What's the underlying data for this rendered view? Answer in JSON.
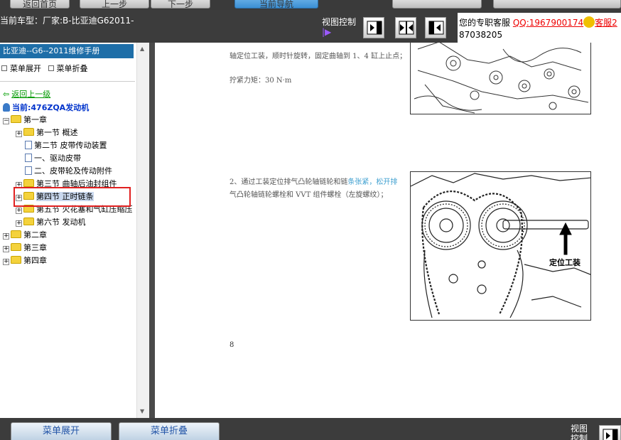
{
  "top_buttons": [
    "返回首页",
    "上一步",
    "下一步",
    "当前导航"
  ],
  "infobar": {
    "car_model": "当前车型：厂家:B-比亚迪G62011-",
    "view_control": "视图控制",
    "view_sub": "|▶",
    "service_prefix": "您的专职客服",
    "service_qq": "QQ:1967900174",
    "service_suffix": "客服2",
    "service_number": "87038205"
  },
  "left": {
    "manual_title": "比亚迪--G6--2011维修手册",
    "expand_label": "菜单展开",
    "collapse_label": "菜单折叠",
    "back_label": "返回上一级",
    "current_label": "当前:476ZQA发动机",
    "tree": [
      {
        "label": "第一章",
        "type": "folder",
        "level": 0,
        "expander": "−"
      },
      {
        "label": "第一节 概述",
        "type": "folder",
        "level": 1,
        "expander": "+"
      },
      {
        "label": "第二节 皮带传动装置",
        "type": "doc",
        "level": 1,
        "expander": ""
      },
      {
        "label": "一、驱动皮带",
        "type": "doc",
        "level": 1,
        "expander": ""
      },
      {
        "label": "二、皮带轮及传动附件",
        "type": "doc",
        "level": 1,
        "expander": ""
      },
      {
        "label": "第三节 曲轴后油封组件",
        "type": "folder",
        "level": 1,
        "expander": "+"
      },
      {
        "label": "第四节 正时链条",
        "type": "folder",
        "level": 1,
        "expander": "+",
        "selected": true
      },
      {
        "label": "第五节 火花塞和气缸压缩压",
        "type": "folder",
        "level": 1,
        "expander": "+"
      },
      {
        "label": "第六节 发动机",
        "type": "folder",
        "level": 1,
        "expander": "+"
      },
      {
        "label": "第二章",
        "type": "folder",
        "level": 0,
        "expander": "+"
      },
      {
        "label": "第三章",
        "type": "folder",
        "level": 0,
        "expander": "+"
      },
      {
        "label": "第四章",
        "type": "folder",
        "level": 0,
        "expander": "+"
      }
    ]
  },
  "document": {
    "line_a": "轴定位工装，顺时针旋转，固定曲轴到 1、4 缸上止点；",
    "torque": "拧紧力矩：30 N·m",
    "step2_a": "2、通过工装定位排气凸轮轴链轮和链",
    "step2_blue": "条张紧，松开排",
    "step2_b": "气凸轮轴链轮螺栓和 VVT 组件螺栓（左旋螺纹）；",
    "figure_label": "定位工装",
    "page_number": "8"
  },
  "bottom": {
    "expand_button": "菜单展开",
    "collapse_button": "菜单折叠",
    "view_control": "视图控制"
  }
}
